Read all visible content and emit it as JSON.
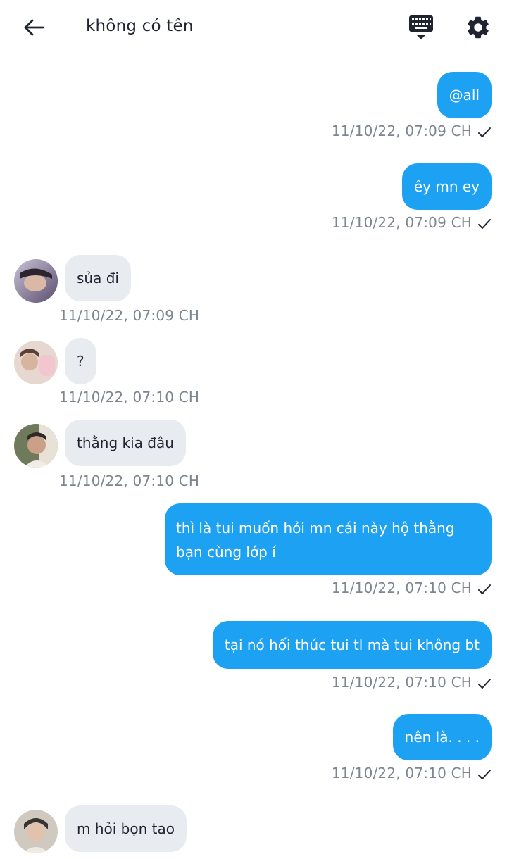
{
  "header": {
    "title": "không có tên",
    "back_icon": "arrow-left-icon",
    "keyboard_icon": "keyboard-icon",
    "settings_icon": "gear-icon"
  },
  "colors": {
    "outgoing_bubble": "#1da1f2",
    "incoming_bubble": "#e8ecf1",
    "timestamp": "#7d8591"
  },
  "messages": [
    {
      "direction": "out",
      "text": "@all",
      "time": "11/10/22,  07:09 CH"
    },
    {
      "direction": "out",
      "text": "êy mn ey",
      "time": "11/10/22,  07:09 CH"
    },
    {
      "direction": "in",
      "text": "sủa đi",
      "time": "11/10/22,  07:09 CH"
    },
    {
      "direction": "in",
      "text": "?",
      "time": "11/10/22,  07:10 CH"
    },
    {
      "direction": "in",
      "text": "thằng kia đâu",
      "time": "11/10/22,  07:10 CH"
    },
    {
      "direction": "out",
      "text": "thì là tui muốn hỏi mn cái này hộ thằng bạn cùng lớp í",
      "time": "11/10/22,  07:10 CH"
    },
    {
      "direction": "out",
      "text": "tại nó hối thúc tui tl mà tui không bt",
      "time": "11/10/22,  07:10 CH"
    },
    {
      "direction": "out",
      "text": "nên là. . . .",
      "time": "11/10/22,  07:10 CH"
    },
    {
      "direction": "in",
      "text": "m hỏi bọn tao"
    }
  ]
}
